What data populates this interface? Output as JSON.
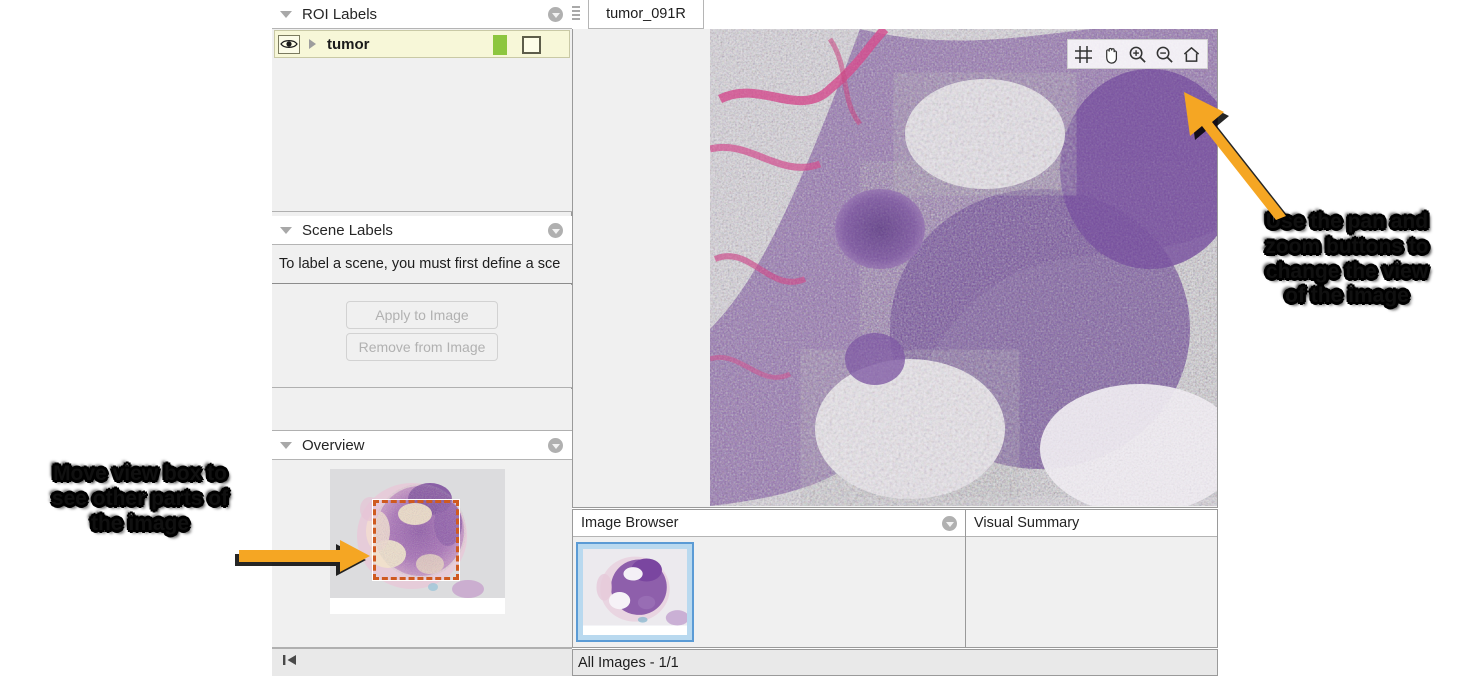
{
  "app": {
    "tab_label": "tumor_091R",
    "status_text": "All Images - 1/1"
  },
  "roi_labels": {
    "header_title": "ROI Labels",
    "collapse_icon": "chevron-down-icon",
    "menu_icon": "panel-menu-icon",
    "rows": [
      {
        "visibility_icon": "eye-icon",
        "expand_icon": "triangle-right-icon",
        "name": "tumor",
        "color": "#8dc63f",
        "shape_icon": "rectangle-roi-icon"
      }
    ]
  },
  "scene_labels": {
    "header_title": "Scene Labels",
    "message": "To label a scene, you must first define a sce",
    "apply_button": "Apply to Image",
    "remove_button": "Remove from Image"
  },
  "overview": {
    "header_title": "Overview",
    "viewbox_color": "#cf5a20"
  },
  "footer": {
    "first_page_icon": "skip-to-first-icon"
  },
  "viewer": {
    "toolbar": [
      {
        "icon": "grid-crosshair-icon",
        "label": "Data tips / grid"
      },
      {
        "icon": "pan-hand-icon",
        "label": "Pan"
      },
      {
        "icon": "zoom-in-icon",
        "label": "Zoom in"
      },
      {
        "icon": "zoom-out-icon",
        "label": "Zoom out"
      },
      {
        "icon": "home-icon",
        "label": "Restore view"
      }
    ]
  },
  "image_browser": {
    "header_title": "Image Browser",
    "menu_icon": "panel-menu-icon",
    "selected_thumbnail_border": "#5b9bd5"
  },
  "visual_summary": {
    "header_title": "Visual Summary"
  },
  "annotations": {
    "arrow_color": "#f5a623",
    "left": {
      "line1": "Move view box to",
      "line2": "see other parts of",
      "line3": "the image"
    },
    "right": {
      "line1": "Use the pan and",
      "line2": "zoom buttons to",
      "line3": "change the view",
      "line4": "of the image"
    }
  }
}
